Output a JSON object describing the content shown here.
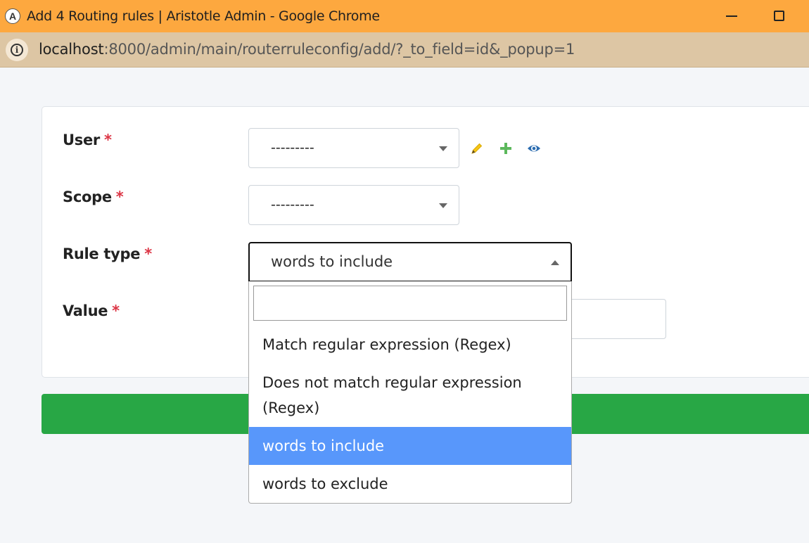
{
  "window": {
    "title": "Add 4 Routing rules | Aristotle Admin - Google Chrome",
    "app_icon_letter": "A"
  },
  "address": {
    "host": "localhost",
    "path": ":8000/admin/main/routerruleconfig/add/?_to_field=id&_popup=1"
  },
  "form": {
    "fields": [
      {
        "label": "User",
        "required_mark": "*"
      },
      {
        "label": "Scope",
        "required_mark": "*"
      },
      {
        "label": "Rule type",
        "required_mark": "*"
      },
      {
        "label": "Value",
        "required_mark": "*"
      }
    ],
    "user_select_value": "---------",
    "scope_select_value": "---------",
    "rule_type_value": "words to include"
  },
  "dropdown": {
    "search_value": "",
    "options": [
      {
        "label": "Match regular expression (Regex)"
      },
      {
        "label_line1": "Does not match regular expression",
        "label_line2": "(Regex)"
      },
      {
        "label": "words to include",
        "selected": true
      },
      {
        "label": "words to exclude"
      }
    ]
  },
  "icons": {
    "edit": "pencil-icon",
    "add": "plus-icon",
    "view": "eye-icon"
  },
  "colors": {
    "titlebar": "#fda83f",
    "addressbar": "#ddc6a4",
    "save_bar": "#28a745",
    "selected_option": "#5897fb",
    "required": "#dc3545"
  }
}
